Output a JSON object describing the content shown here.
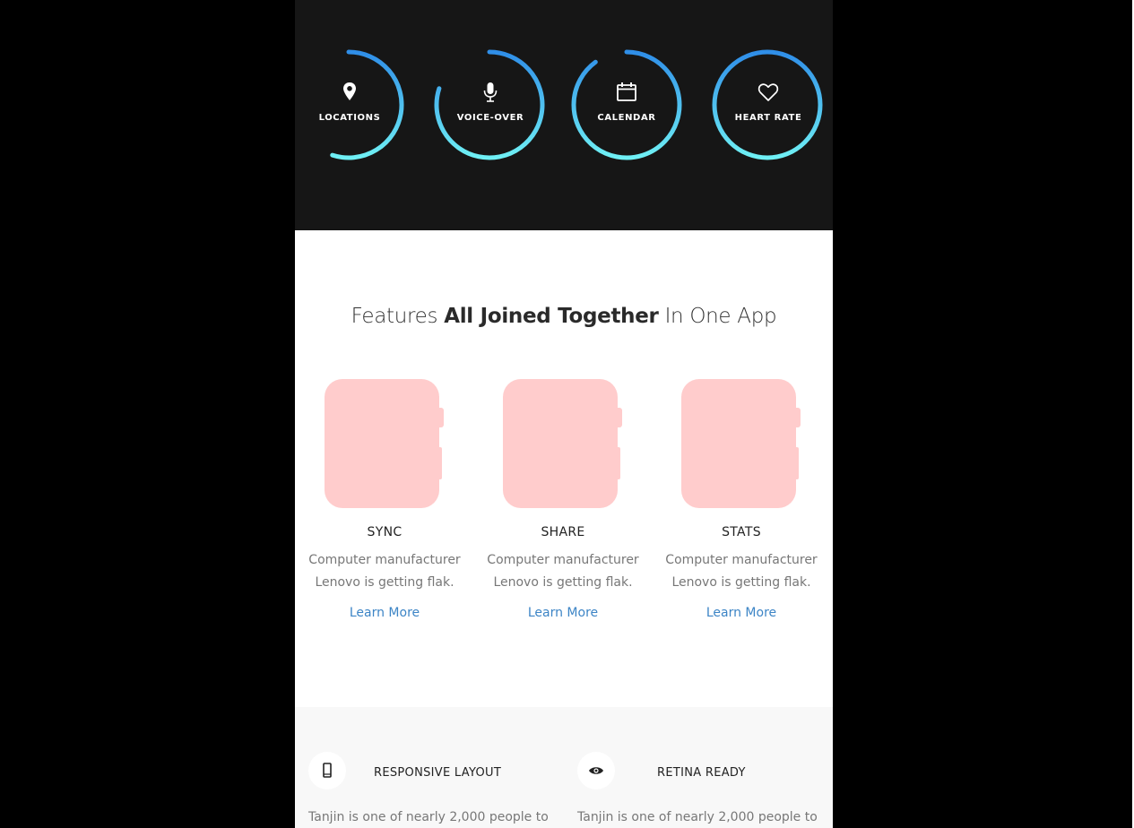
{
  "rings": [
    {
      "label": "LOCATIONS",
      "icon": "map-pin-icon",
      "progress": 0.55
    },
    {
      "label": "VOICE-OVER",
      "icon": "microphone-icon",
      "progress": 0.8
    },
    {
      "label": "CALENDAR",
      "icon": "calendar-icon",
      "progress": 0.9
    },
    {
      "label": "HEART RATE",
      "icon": "heart-icon",
      "progress": 1.0
    }
  ],
  "features": {
    "title_pre": "Features ",
    "title_bold": "All Joined Together",
    "title_post": " In One App",
    "items": [
      {
        "name": "SYNC",
        "desc": "Computer manufacturer Lenovo is getting flak.",
        "link": "Learn More"
      },
      {
        "name": "SHARE",
        "desc": "Computer manufacturer Lenovo is getting flak.",
        "link": "Learn More"
      },
      {
        "name": "STATS",
        "desc": "Computer manufacturer Lenovo is getting flak.",
        "link": "Learn More"
      }
    ]
  },
  "bottom": {
    "items": [
      {
        "title": "RESPONSIVE LAYOUT",
        "icon": "mobile-phone-icon",
        "text": "Tanjin is one of nearly 2,000 people to"
      },
      {
        "title": "RETINA READY",
        "icon": "eye-icon",
        "text": "Tanjin is one of nearly 2,000 people to"
      }
    ]
  },
  "colors": {
    "dark_band": "#161616",
    "ring_start": "#2f8ee8",
    "ring_end": "#6ff0f5",
    "watch_placeholder": "#ffcccc",
    "link": "#3d85c6",
    "grey_band": "#f8f8f8"
  }
}
